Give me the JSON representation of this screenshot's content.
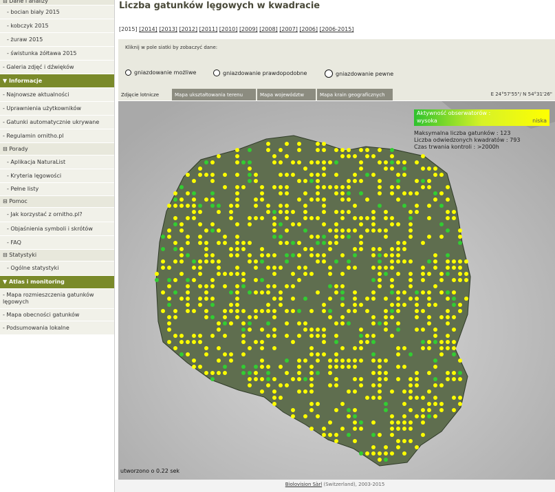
{
  "sidebar": {
    "items": [
      {
        "label": "⊟ Dane i analizy",
        "kind": "grp"
      },
      {
        "label": "- bocian biały 2015",
        "kind": "sub"
      },
      {
        "label": "- kobczyk 2015",
        "kind": "sub"
      },
      {
        "label": "- żuraw 2015",
        "kind": "sub"
      },
      {
        "label": "- świstunka żółtawa 2015",
        "kind": "sub"
      },
      {
        "label": "- Galeria zdjęć i dźwięków",
        "kind": "top"
      },
      {
        "label": "▼ Informacje",
        "kind": "hdr"
      },
      {
        "label": "- Najnowsze aktualności",
        "kind": "top"
      },
      {
        "label": "- Uprawnienia użytkowników",
        "kind": "top"
      },
      {
        "label": "- Gatunki automatycznie ukrywane",
        "kind": "top"
      },
      {
        "label": "- Regulamin ornitho.pl",
        "kind": "top"
      },
      {
        "label": "⊟ Porady",
        "kind": "grp"
      },
      {
        "label": "- Aplikacja NaturaList",
        "kind": "sub"
      },
      {
        "label": "- Kryteria lęgowości",
        "kind": "sub"
      },
      {
        "label": "- Pełne listy",
        "kind": "sub"
      },
      {
        "label": "⊟ Pomoc",
        "kind": "grp"
      },
      {
        "label": "- Jak korzystać z ornitho.pl?",
        "kind": "sub"
      },
      {
        "label": "- Objaśnienia symboli i skrótów",
        "kind": "sub"
      },
      {
        "label": "- FAQ",
        "kind": "sub"
      },
      {
        "label": "⊟ Statystyki",
        "kind": "grp"
      },
      {
        "label": "- Ogólne statystyki",
        "kind": "sub"
      },
      {
        "label": "▼ Atlas i monitoring",
        "kind": "hdr"
      },
      {
        "label": "- Mapa rozmieszczenia gatunków lęgowych",
        "kind": "top"
      },
      {
        "label": "- Mapa obecności gatunków",
        "kind": "top"
      },
      {
        "label": "- Podsumowania lokalne",
        "kind": "top"
      }
    ]
  },
  "page": {
    "title": "Liczba gatunków lęgowych w kwadracie",
    "year_current": "[2015]",
    "year_links": [
      "[2014]",
      "[2013]",
      "[2012]",
      "[2011]",
      "[2010]",
      "[2009]",
      "[2008]",
      "[2007]",
      "[2006]",
      "[2006-2015]"
    ],
    "click_info": "Kliknij w pole siatki by zobaczyć dane:",
    "radios": [
      "gniazdowanie możliwe",
      "gniazdowanie prawdopodobne",
      "gniazdowanie pewne"
    ]
  },
  "map": {
    "tabs": [
      "Zdjęcie lotnicze",
      "Mapa ukształtowania terenu",
      "Mapa województw",
      "Mapa krain geograficznych"
    ],
    "active_tab": "Zdjęcie lotnicze",
    "coords": "E 24°57'55\"/ N 54°31'26\"",
    "activity_title": "Aktywność obserwatorów :",
    "activity_high": "wysoka",
    "activity_low": "niska",
    "stats": [
      "Maksymalna liczba gatunków : 123",
      "Liczba odwiedzonych kwadratów : 793",
      "Czas trwania kontroli : >2000h"
    ],
    "created": "utworzono o 0.22 sek",
    "colors": {
      "dot_yellow": "#ffff00",
      "dot_green": "#32cd32",
      "land": "#5f6e4f",
      "gradient_start": "#2ec22e",
      "gradient_end": "#ffff00"
    }
  },
  "footer": {
    "link": "Biolovision Sàrl",
    "text": " (Switzerland), 2003-2015"
  }
}
